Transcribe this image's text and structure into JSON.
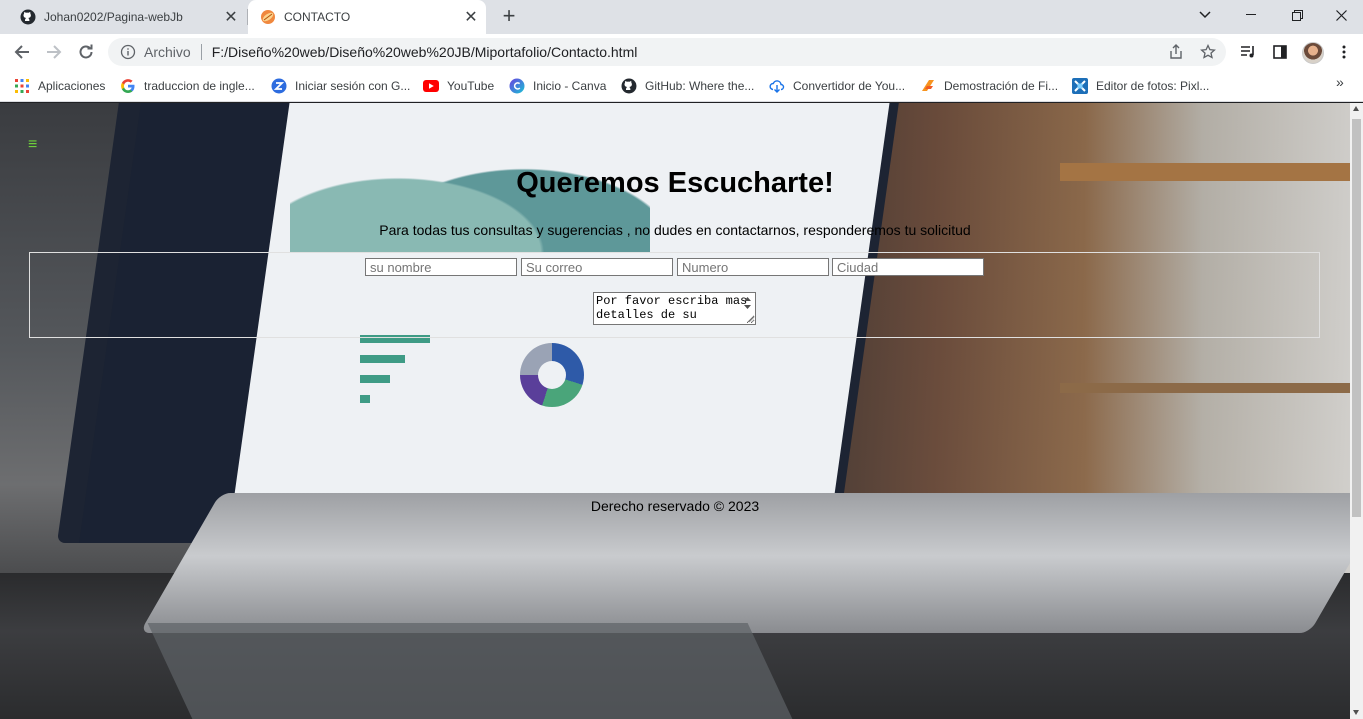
{
  "browser": {
    "tabs": [
      {
        "title": "Johan0202/Pagina-webJb",
        "icon": "github-icon",
        "active": false
      },
      {
        "title": "CONTACTO",
        "icon": "firefox-like-orange-icon",
        "active": true
      }
    ],
    "address": {
      "scheme_label": "Archivo",
      "url": "F:/Diseño%20web/Diseño%20web%20JB/Miportafolio/Contacto.html"
    },
    "bookmarks": [
      {
        "label": "Aplicaciones",
        "icon": "apps-grid-icon"
      },
      {
        "label": "traduccion de ingle...",
        "icon": "google-icon"
      },
      {
        "label": "Iniciar sesión con G...",
        "icon": "z-logo-icon"
      },
      {
        "label": "YouTube",
        "icon": "youtube-icon"
      },
      {
        "label": "Inicio - Canva",
        "icon": "canva-icon"
      },
      {
        "label": "GitHub: Where the...",
        "icon": "github-icon"
      },
      {
        "label": "Convertidor de You...",
        "icon": "download-cloud-icon"
      },
      {
        "label": "Demostración de Fi...",
        "icon": "figma-like-icon"
      },
      {
        "label": "Editor de fotos: Pixl...",
        "icon": "pixlr-icon"
      }
    ],
    "colors": {
      "tabstrip": "#dee1e6",
      "toolbar": "#ffffff",
      "omnibox": "#f1f3f4"
    }
  },
  "page": {
    "menu_icon": "≡",
    "title": "Queremos Escucharte!",
    "subtitle": "Para todas tus consultas y sugerencias , no dudes en contactarnos, responderemos tu solicitud",
    "form": {
      "name_placeholder": "su nombre",
      "email_placeholder": "Su correo",
      "phone_placeholder": "Numero",
      "city_placeholder": "Ciudad",
      "message_text": "Por favor escriba mas detalles de su"
    },
    "footer": "Derecho reservado © 2023",
    "accent_color": "#6ecf3b"
  }
}
